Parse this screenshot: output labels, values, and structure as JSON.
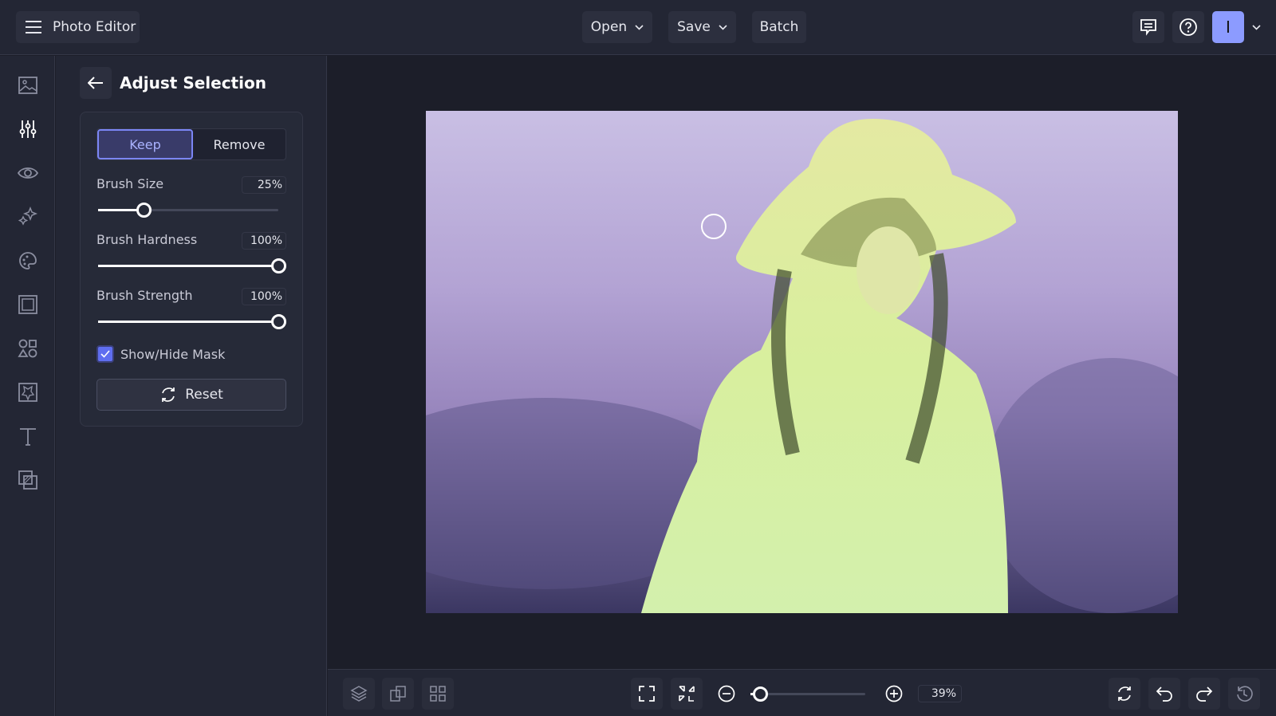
{
  "header": {
    "app_title": "Photo Editor",
    "open_label": "Open",
    "save_label": "Save",
    "batch_label": "Batch",
    "avatar_initial": "I"
  },
  "sidebar": {
    "items": [
      "image-icon",
      "adjust-icon",
      "eye-icon",
      "sparkle-icon",
      "palette-icon",
      "frame-icon",
      "shapes-icon",
      "texture-icon",
      "text-icon",
      "overlay-icon"
    ],
    "active": "adjust-icon"
  },
  "panel": {
    "title": "Adjust Selection",
    "keep_label": "Keep",
    "remove_label": "Remove",
    "mode": "Keep",
    "sliders": [
      {
        "label": "Brush Size",
        "value": "25%",
        "level": 25
      },
      {
        "label": "Brush Hardness",
        "value": "100%",
        "level": 100
      },
      {
        "label": "Brush Strength",
        "value": "100%",
        "level": 100
      }
    ],
    "mask_label": "Show/Hide Mask",
    "mask_checked": true,
    "reset_label": "Reset"
  },
  "bottom": {
    "zoom": "39%",
    "zoom_level": 8
  },
  "colors": {
    "accent": "#7b86f5",
    "avatar": "#8c9bff"
  }
}
